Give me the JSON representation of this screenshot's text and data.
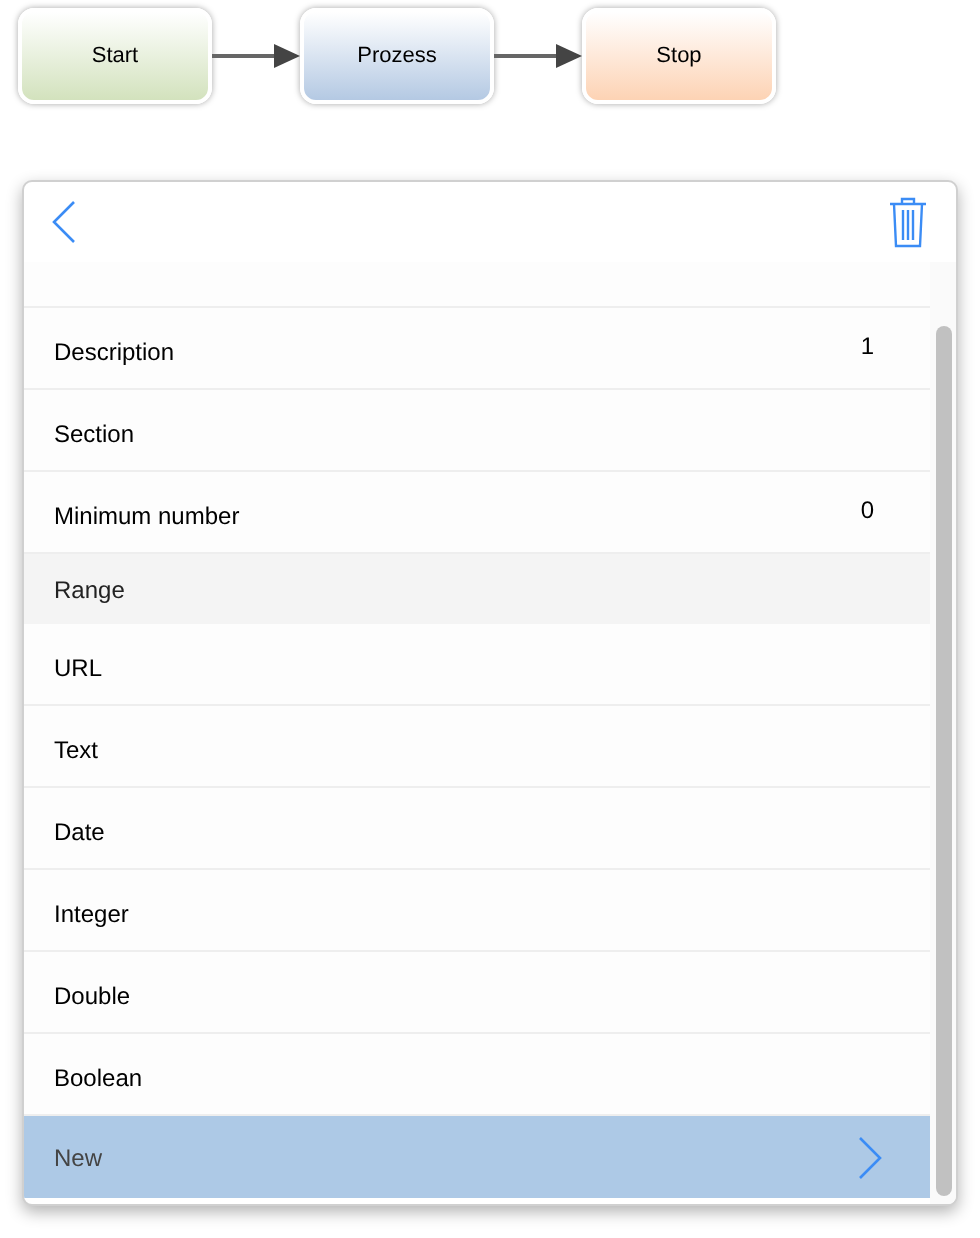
{
  "flow": {
    "nodes": [
      {
        "label": "Start",
        "color": "#d3e2bd"
      },
      {
        "label": "Prozess",
        "color": "#b4c9e3"
      },
      {
        "label": "Stop",
        "color": "#fdd3b4"
      }
    ]
  },
  "rows": [
    {
      "kind": "field",
      "label": "Description",
      "value": "1",
      "selected": false
    },
    {
      "kind": "field",
      "label": "Section",
      "selected": false
    },
    {
      "kind": "field",
      "label": "Minimum number",
      "value": "0",
      "selected": false
    },
    {
      "kind": "header",
      "label": "Range",
      "selected": false
    },
    {
      "kind": "field",
      "label": "URL",
      "selected": false
    },
    {
      "kind": "field",
      "label": "Text",
      "selected": false
    },
    {
      "kind": "field",
      "label": "Date",
      "selected": false
    },
    {
      "kind": "field",
      "label": "Integer",
      "selected": false
    },
    {
      "kind": "field",
      "label": "Double",
      "selected": false
    },
    {
      "kind": "field",
      "label": "Boolean",
      "selected": false
    },
    {
      "kind": "action",
      "label": "New",
      "selected": true
    }
  ]
}
